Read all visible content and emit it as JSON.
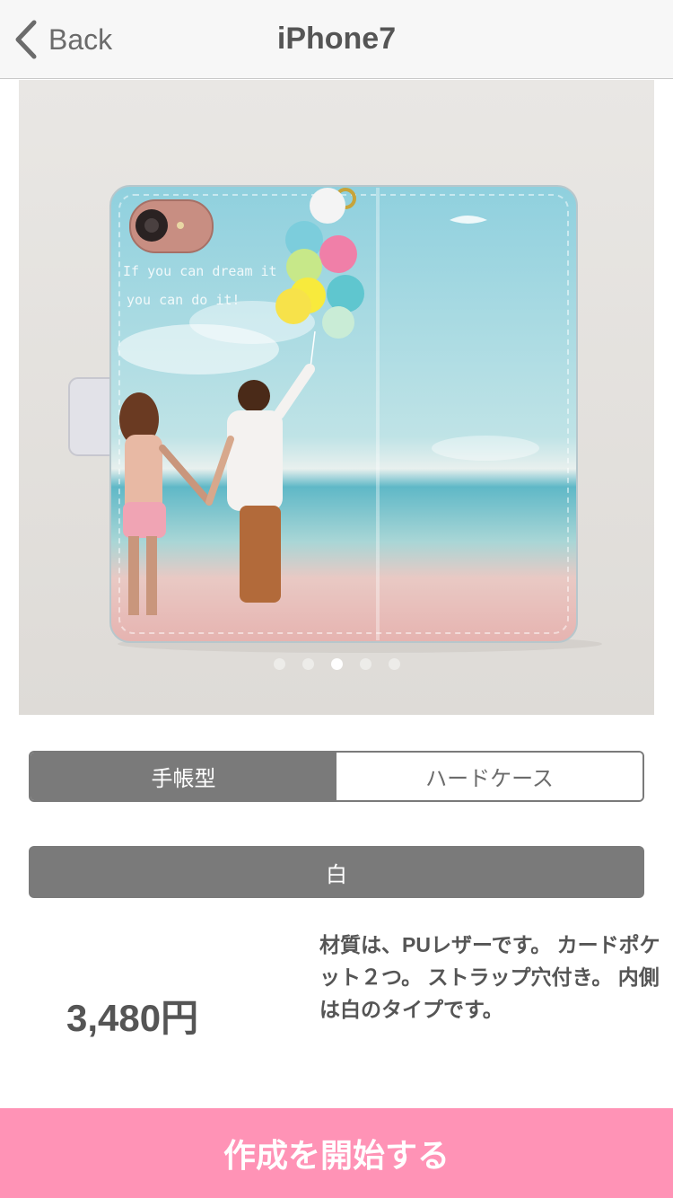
{
  "nav": {
    "back_label": "Back",
    "title": "iPhone7"
  },
  "product_image": {
    "case_text_line1": "If you can dream it",
    "case_text_line2": "you can do it!",
    "carousel_total": 5,
    "carousel_active_index": 3
  },
  "case_type": {
    "options": [
      "手帳型",
      "ハードケース"
    ],
    "selected": "手帳型"
  },
  "color": {
    "selected_label": "白"
  },
  "price": "3,480円",
  "description": "材質は、PUレザーです。 カードポケット２つ。 ストラップ穴付き。 内側は白のタイプです。",
  "cta_label": "作成を開始する",
  "colors": {
    "nav_bg": "#f7f7f7",
    "segment_gray": "#7a7a7a",
    "cta_pink": "#ff93b6",
    "text_gray": "#555555"
  }
}
